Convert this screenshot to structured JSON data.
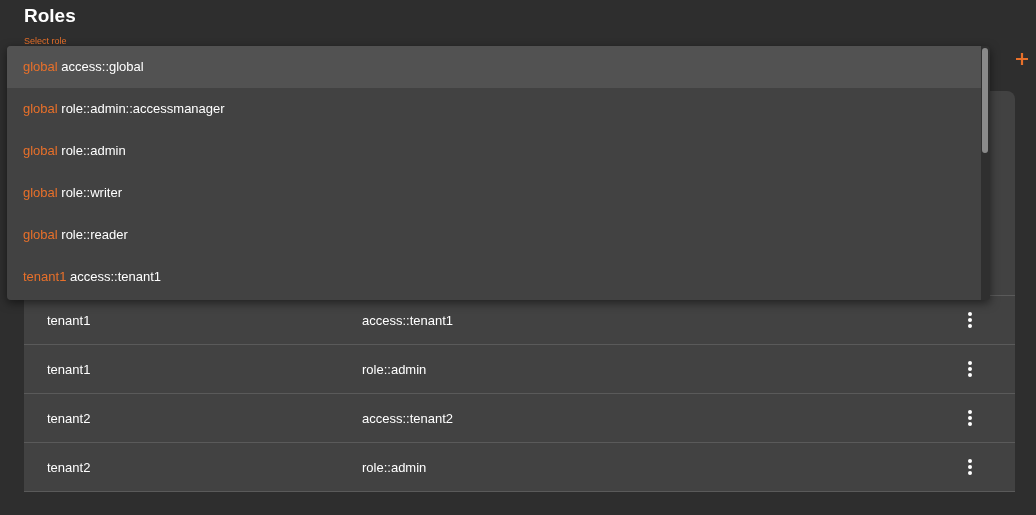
{
  "title": "Roles",
  "select": {
    "label": "Select role",
    "options": [
      {
        "scope": "global",
        "role": "access::global",
        "selected": true
      },
      {
        "scope": "global",
        "role": "role::admin::accessmanager",
        "selected": false
      },
      {
        "scope": "global",
        "role": "role::admin",
        "selected": false
      },
      {
        "scope": "global",
        "role": "role::writer",
        "selected": false
      },
      {
        "scope": "global",
        "role": "role::reader",
        "selected": false
      },
      {
        "scope": "tenant1",
        "role": "access::tenant1",
        "selected": false
      }
    ]
  },
  "table": {
    "rows": [
      {
        "tenant": "tenant1",
        "role": "access::tenant1"
      },
      {
        "tenant": "tenant1",
        "role": "role::admin"
      },
      {
        "tenant": "tenant2",
        "role": "access::tenant2"
      },
      {
        "tenant": "tenant2",
        "role": "role::admin"
      }
    ]
  }
}
